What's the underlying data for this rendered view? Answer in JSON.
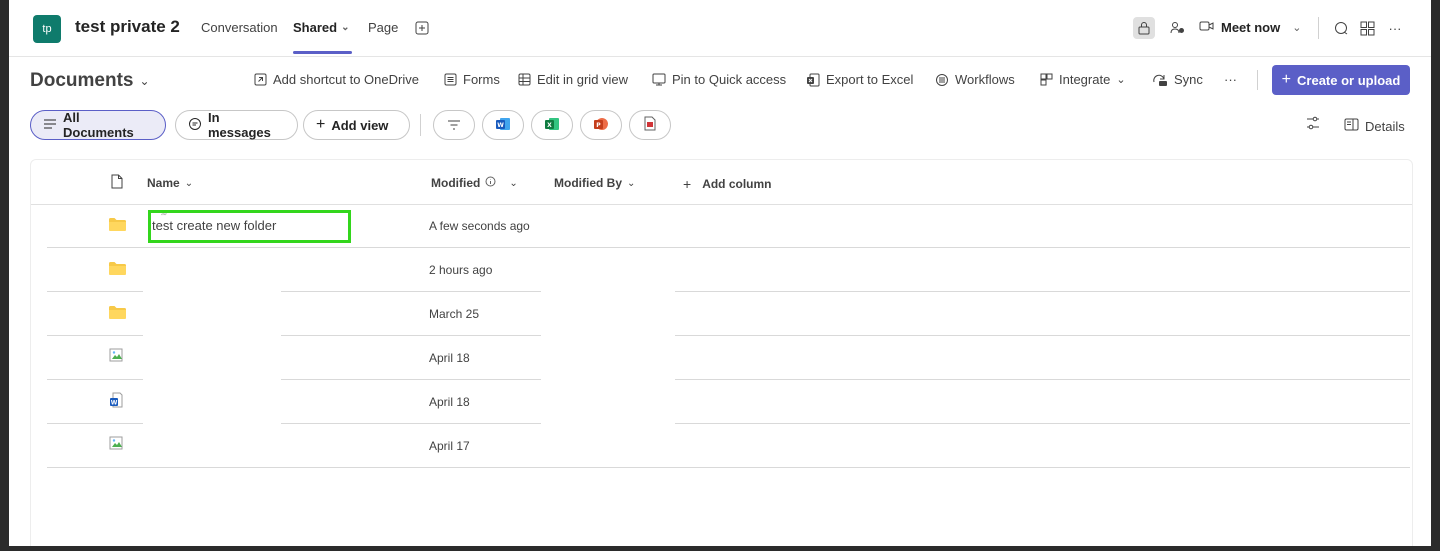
{
  "header": {
    "team_avatar": "tp",
    "team_name": "test private 2",
    "tabs": [
      {
        "label": "Conversation"
      },
      {
        "label": "Shared",
        "active": true
      },
      {
        "label": "Page"
      }
    ],
    "add_tab_icon": "plus-square-icon",
    "meet_now_label": "Meet now",
    "more_label": "···"
  },
  "commandbar": {
    "title": "Documents",
    "items": [
      {
        "label": "Add shortcut to OneDrive",
        "icon": "shortcut-icon"
      },
      {
        "label": "Forms",
        "icon": "forms-icon"
      },
      {
        "label": "Edit in grid view",
        "icon": "grid-icon"
      },
      {
        "label": "Pin to Quick access",
        "icon": "pin-icon"
      },
      {
        "label": "Export to Excel",
        "icon": "excel-icon"
      },
      {
        "label": "Workflows",
        "icon": "workflows-icon"
      },
      {
        "label": "Integrate",
        "icon": "integrate-icon"
      },
      {
        "label": "Sync",
        "icon": "sync-icon"
      }
    ],
    "more_label": "···",
    "create_label": "Create or upload"
  },
  "views": {
    "all_documents": "All Documents",
    "in_messages": "In messages",
    "add_view": "Add view",
    "details_label": "Details"
  },
  "list": {
    "columns": {
      "name": "Name",
      "modified": "Modified",
      "modified_by": "Modified By",
      "add_column": "Add column"
    },
    "rows": [
      {
        "name": "test create new folder",
        "modified": "A few seconds ago",
        "type": "folder"
      },
      {
        "name": "",
        "modified": "2 hours ago",
        "type": "folder"
      },
      {
        "name": "",
        "modified": "March 25",
        "type": "folder"
      },
      {
        "name": "",
        "modified": "April 18",
        "type": "image"
      },
      {
        "name": "",
        "modified": "April 18",
        "type": "word"
      },
      {
        "name": "",
        "modified": "April 17",
        "type": "image"
      }
    ]
  },
  "colors": {
    "accent": "#5b5fc7",
    "highlight": "#33d61c",
    "folder": "#f7c948"
  }
}
